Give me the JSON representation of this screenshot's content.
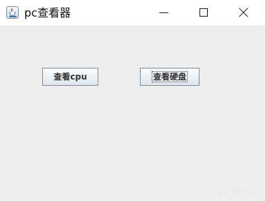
{
  "window": {
    "title": "pc查看器",
    "app_icon": "java-cup-icon",
    "controls": {
      "minimize_icon": "minimize-icon",
      "maximize_icon": "maximize-icon",
      "close_icon": "close-icon"
    }
  },
  "main": {
    "buttons": {
      "cpu_label": "查看cpu",
      "disk_label": "查看硬盘"
    }
  },
  "watermark": "CSDN @ABUCC7",
  "colors": {
    "titlebar": "#ffffff",
    "content_bg": "#eeeeee",
    "button_border": "#7a8a99"
  }
}
